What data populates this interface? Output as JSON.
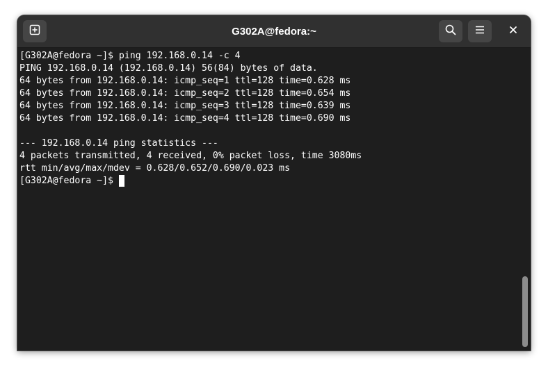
{
  "window": {
    "title": "G302A@fedora:~"
  },
  "header": {
    "new_tab_icon": "new-tab-icon",
    "search_icon": "search-icon",
    "menu_icon": "hamburger-menu-icon",
    "close_icon": "close-icon"
  },
  "terminal": {
    "lines": [
      "[G302A@fedora ~]$ ping 192.168.0.14 -c 4",
      "PING 192.168.0.14 (192.168.0.14) 56(84) bytes of data.",
      "64 bytes from 192.168.0.14: icmp_seq=1 ttl=128 time=0.628 ms",
      "64 bytes from 192.168.0.14: icmp_seq=2 ttl=128 time=0.654 ms",
      "64 bytes from 192.168.0.14: icmp_seq=3 ttl=128 time=0.639 ms",
      "64 bytes from 192.168.0.14: icmp_seq=4 ttl=128 time=0.690 ms",
      "",
      "--- 192.168.0.14 ping statistics ---",
      "4 packets transmitted, 4 received, 0% packet loss, time 3080ms",
      "rtt min/avg/max/mdev = 0.628/0.652/0.690/0.023 ms"
    ],
    "prompt": "[G302A@fedora ~]$ "
  },
  "colors": {
    "terminal_bg": "#1e1e1e",
    "headerbar_bg": "#303030",
    "text": "#ffffff"
  }
}
